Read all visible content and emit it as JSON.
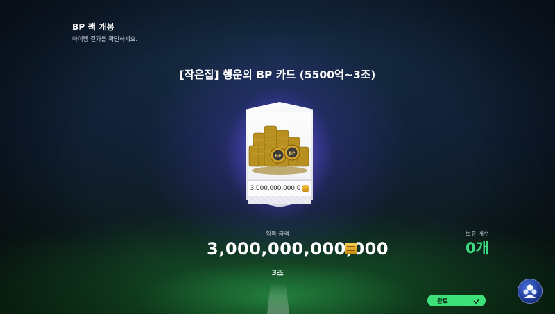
{
  "header": {
    "title": "BP 팩 개봉",
    "subtitle": "아이템 결과를 확인하세요."
  },
  "pack": {
    "title": "[작은집] 행운의 BP 카드 (5500억~3조)"
  },
  "card": {
    "value": "3,000,000,000,0",
    "art_icon": "bp-coin-stack-icon",
    "currency_icon": "bp-currency-icon"
  },
  "result": {
    "label": "획득 금액",
    "amount": "3,000,000,000,000",
    "short": "3조"
  },
  "owned": {
    "label": "보유 개수",
    "value": "0개"
  },
  "actions": {
    "done_label": "완료"
  },
  "colors": {
    "accent_green": "#3ee07a",
    "owned_green": "#3ddc84",
    "card_glow": "#6c60ff",
    "gold": "#f6c44a"
  }
}
